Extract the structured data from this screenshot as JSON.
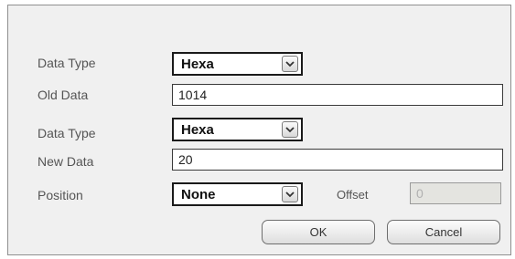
{
  "form": {
    "source": {
      "data_type_label": "Data Type",
      "data_type_value": "Hexa",
      "data_label": "Old Data",
      "data_value": "1014"
    },
    "target": {
      "data_type_label": "Data Type",
      "data_type_value": "Hexa",
      "data_label": "New Data",
      "data_value": "20"
    },
    "position": {
      "label": "Position",
      "value": "None"
    },
    "offset": {
      "label": "Offset",
      "value": "0"
    }
  },
  "buttons": {
    "ok_label": "OK",
    "cancel_label": "Cancel"
  },
  "icons": {
    "dropdown": "chevron-down-icon"
  },
  "colors": {
    "dialog_background": "#f0f0f0",
    "disabled_field": "#e4e4e0"
  }
}
